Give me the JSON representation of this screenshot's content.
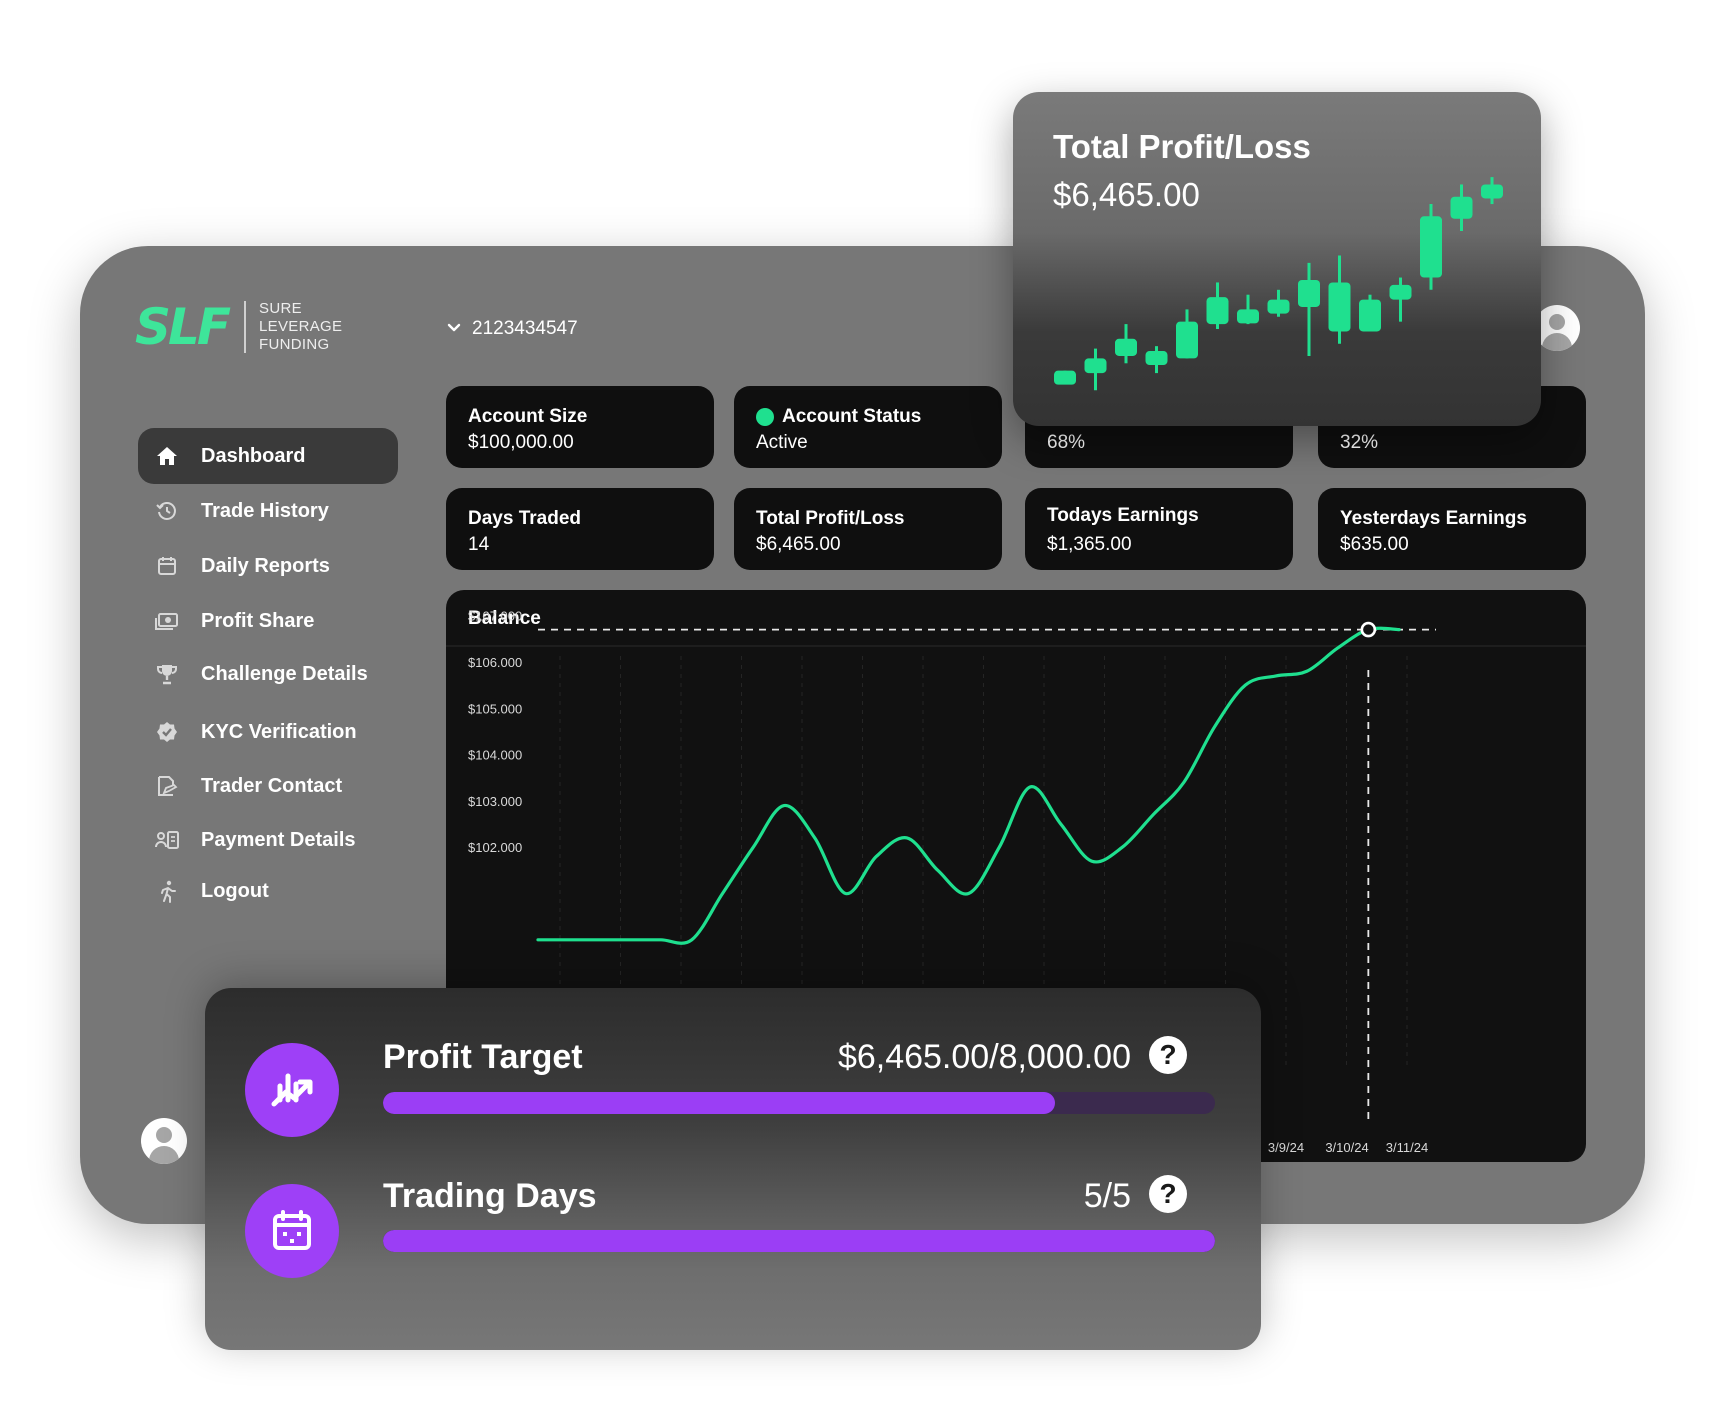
{
  "brand": {
    "logo_text": "SLF",
    "subtitle_lines": [
      "SURE",
      "LEVERAGE",
      "FUNDING"
    ],
    "accent_color": "#3ee59a"
  },
  "account": {
    "number": "2123434547"
  },
  "sidebar": {
    "items": [
      {
        "label": "Dashboard",
        "icon": "home-icon",
        "active": true
      },
      {
        "label": "Trade History",
        "icon": "history-icon"
      },
      {
        "label": "Daily Reports",
        "icon": "calendar-icon"
      },
      {
        "label": "Profit Share",
        "icon": "money-icon"
      },
      {
        "label": "Challenge Details",
        "icon": "trophy-icon"
      },
      {
        "label": "KYC Verification",
        "icon": "verified-badge-icon"
      },
      {
        "label": "Trader Contact",
        "icon": "contact-icon"
      },
      {
        "label": "Payment Details",
        "icon": "payment-icon"
      },
      {
        "label": "Logout",
        "icon": "logout-icon"
      }
    ]
  },
  "stats": {
    "row1": [
      {
        "label": "Account Size",
        "value": "$100,000.00"
      },
      {
        "label": "Account Status",
        "value": "Active",
        "status_color": "#1fe08f"
      },
      {
        "label": "",
        "value": "68%"
      },
      {
        "label": "",
        "value": "32%"
      }
    ],
    "row2": [
      {
        "label": "Days Traded",
        "value": "14"
      },
      {
        "label": "Total Profit/Loss",
        "value": "$6,465.00"
      },
      {
        "label": "Todays Earnings",
        "value": "$1,365.00"
      },
      {
        "label": "Yesterdays Earnings",
        "value": "$635.00"
      }
    ]
  },
  "balance": {
    "title": "Balance"
  },
  "profit_loss_card": {
    "title": "Total Profit/Loss",
    "value": "$6,465.00"
  },
  "progress": {
    "profit_target": {
      "label": "Profit Target",
      "value": "$6,465.00/8,000.00",
      "fraction": 0.808
    },
    "trading_days": {
      "label": "Trading Days",
      "value": "5/5",
      "fraction": 1.0
    },
    "help_symbol": "?",
    "bar_color": "#9b3ef5"
  },
  "chart_data": [
    {
      "type": "line",
      "title": "Balance",
      "y_tick_labels": [
        "$108.000",
        "$107.000",
        "$106.000",
        "$105.000",
        "$104.000",
        "$103.000",
        "$102.000"
      ],
      "y_ticks": [
        108000,
        107000,
        106000,
        105000,
        104000,
        103000,
        102000
      ],
      "x_tick_labels": [
        "3/8/24",
        "3/9/24",
        "3/10/24",
        "3/11/24"
      ],
      "series": [
        {
          "x": [
            0,
            0.5,
            1,
            1.5,
            2,
            2.5,
            3,
            3.5,
            4,
            4.5,
            5,
            5.5,
            6,
            6.5,
            7,
            7.5,
            8,
            8.5,
            9,
            9.5,
            10,
            10.5,
            11,
            11.5,
            12,
            12.5,
            13,
            13.5,
            14
          ],
          "y": [
            100000,
            100000,
            100000,
            100000,
            100000,
            100000,
            101000,
            102000,
            102900,
            102200,
            101000,
            101800,
            102200,
            101500,
            101000,
            102000,
            103300,
            102500,
            101700,
            102000,
            102700,
            103400,
            104600,
            105500,
            105700,
            105800,
            106300,
            106700,
            106700
          ],
          "color": "#1fe08f"
        }
      ],
      "crosshair": {
        "x": 13.5,
        "y": 106700
      },
      "grid": "vertical dashed"
    },
    {
      "type": "candlestick",
      "title": "Total Profit/Loss",
      "candles": [
        {
          "open": 0.0,
          "close": 0.3,
          "high": 0.3,
          "low": 0.0
        },
        {
          "open": 0.2,
          "close": 0.8,
          "high": 1.2,
          "low": -0.5
        },
        {
          "open": 0.9,
          "close": 1.6,
          "high": 2.2,
          "low": 0.6
        },
        {
          "open": 0.6,
          "close": 1.1,
          "high": 1.3,
          "low": 0.2
        },
        {
          "open": 0.8,
          "close": 2.3,
          "high": 2.8,
          "low": 0.8
        },
        {
          "open": 2.2,
          "close": 3.3,
          "high": 3.9,
          "low": 2.0
        },
        {
          "open": 2.4,
          "close": 2.8,
          "high": 3.4,
          "low": 2.2
        },
        {
          "open": 2.7,
          "close": 3.2,
          "high": 3.6,
          "low": 2.5
        },
        {
          "open": 2.9,
          "close": 4.0,
          "high": 4.7,
          "low": 0.9
        },
        {
          "open": 1.9,
          "close": 3.9,
          "high": 5.0,
          "low": 1.4
        },
        {
          "open": 1.9,
          "close": 3.2,
          "high": 3.4,
          "low": 1.9
        },
        {
          "open": 3.2,
          "close": 3.8,
          "high": 4.1,
          "low": 2.3
        },
        {
          "open": 4.1,
          "close": 6.6,
          "high": 7.1,
          "low": 3.6
        },
        {
          "open": 6.5,
          "close": 7.4,
          "high": 7.9,
          "low": 6.0
        },
        {
          "open": 7.5,
          "close": 7.9,
          "high": 8.2,
          "low": 7.1
        }
      ],
      "color": "#1fe08f"
    }
  ]
}
